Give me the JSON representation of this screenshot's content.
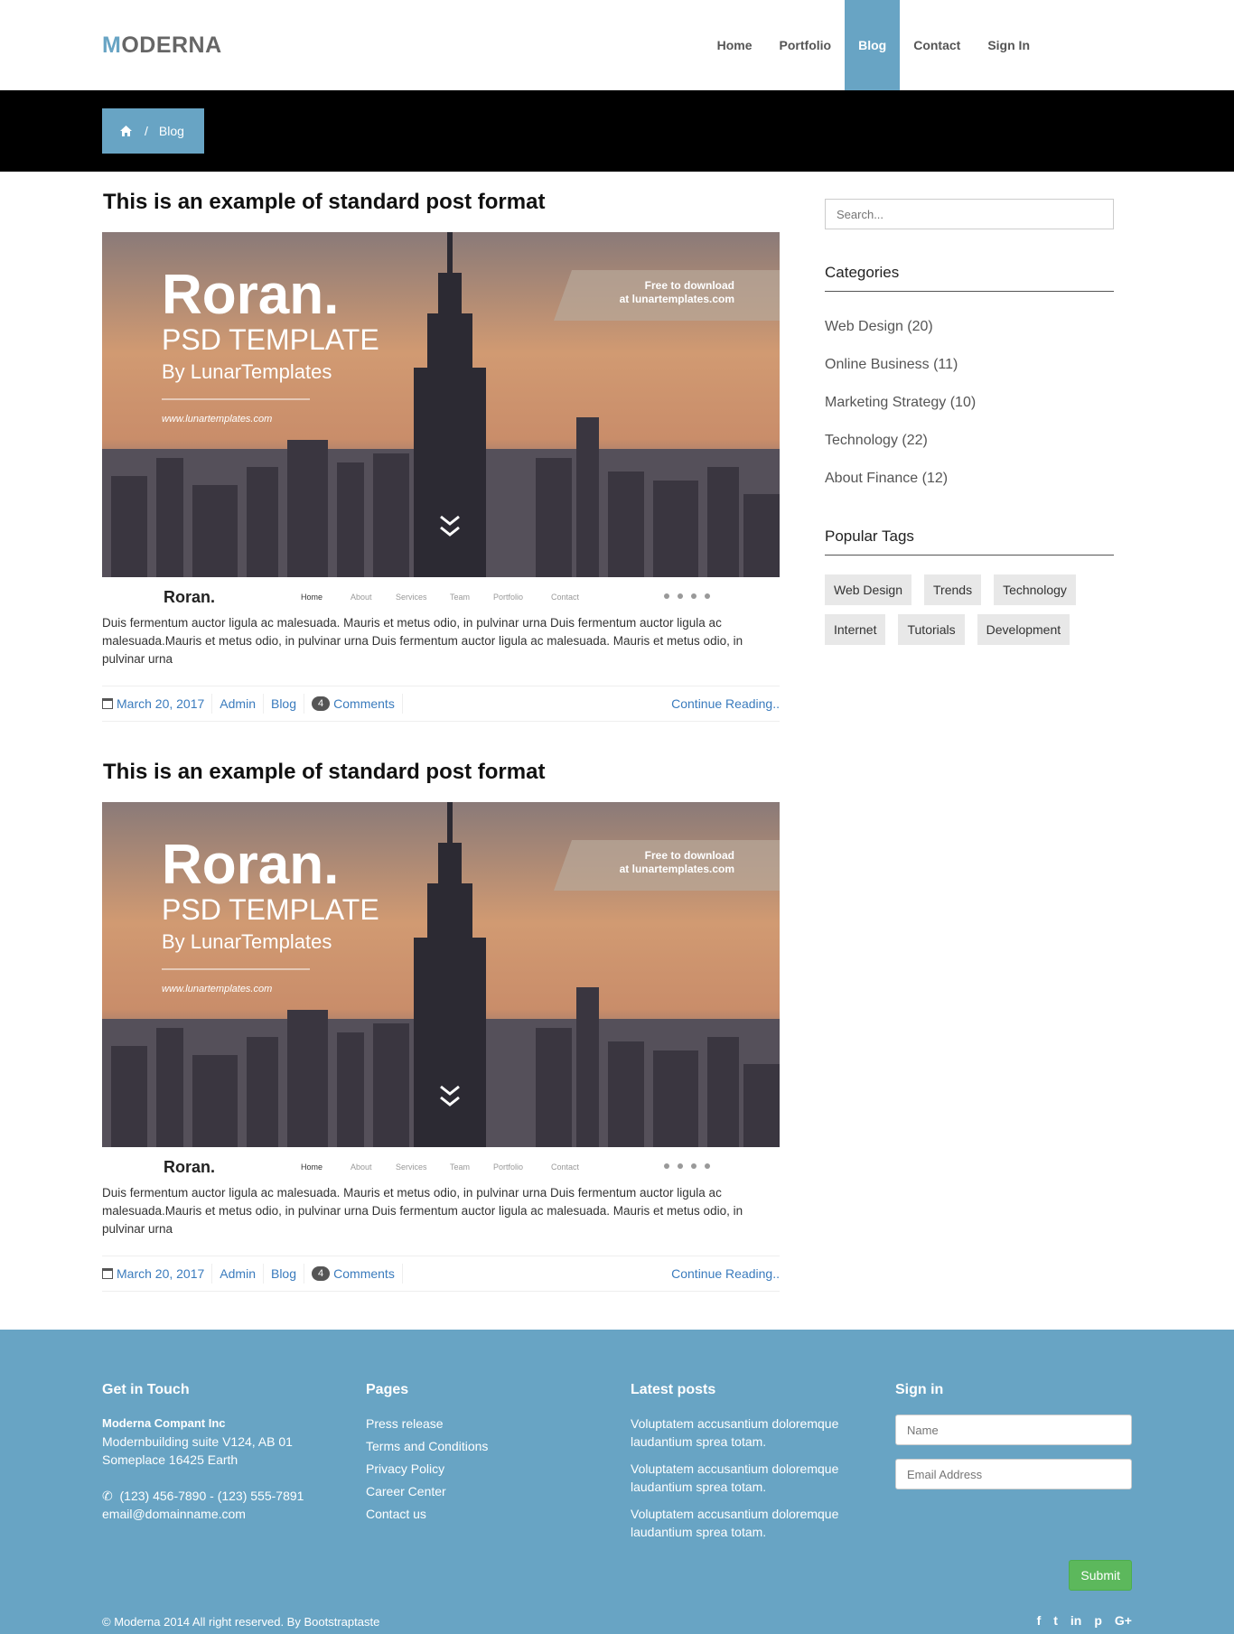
{
  "brand": {
    "first_letter": "M",
    "rest": "ODERNA"
  },
  "nav": {
    "home": "Home",
    "portfolio": "Portfolio",
    "blog": "Blog",
    "contact": "Contact",
    "signin": "Sign In"
  },
  "breadcrumb": {
    "separator": "/",
    "current": "Blog"
  },
  "posts": [
    {
      "title": "This is an example of standard post format",
      "image": {
        "headline": "Roran.",
        "subhead": "PSD TEMPLATE",
        "byline": "By LunarTemplates",
        "url": "www.lunartemplates.com",
        "ribbon1": "Free to download",
        "ribbon2": "at lunartemplates.com",
        "nav_brand": "Roran.",
        "nav_items": [
          "Home",
          "About",
          "Services",
          "Team",
          "Portfolio",
          "Contact"
        ]
      },
      "excerpt": "Duis fermentum auctor ligula ac malesuada. Mauris et metus odio, in pulvinar urna Duis fermentum auctor ligula ac malesuada.Mauris et metus odio, in pulvinar urna Duis fermentum auctor ligula ac malesuada. Mauris et metus odio, in pulvinar urna",
      "date": "March 20, 2017",
      "author": "Admin",
      "category": "Blog",
      "comment_count": "4",
      "comments_label": "Comments",
      "continue": "Continue Reading.."
    },
    {
      "title": "This is an example of standard post format",
      "image": {
        "headline": "Roran.",
        "subhead": "PSD TEMPLATE",
        "byline": "By LunarTemplates",
        "url": "www.lunartemplates.com",
        "ribbon1": "Free to download",
        "ribbon2": "at lunartemplates.com",
        "nav_brand": "Roran.",
        "nav_items": [
          "Home",
          "About",
          "Services",
          "Team",
          "Portfolio",
          "Contact"
        ]
      },
      "excerpt": "Duis fermentum auctor ligula ac malesuada. Mauris et metus odio, in pulvinar urna Duis fermentum auctor ligula ac malesuada.Mauris et metus odio, in pulvinar urna Duis fermentum auctor ligula ac malesuada. Mauris et metus odio, in pulvinar urna",
      "date": "March 20, 2017",
      "author": "Admin",
      "category": "Blog",
      "comment_count": "4",
      "comments_label": "Comments",
      "continue": "Continue Reading.."
    }
  ],
  "sidebar": {
    "search_placeholder": "Search...",
    "categories_title": "Categories",
    "categories": [
      "Web Design (20)",
      "Online Business (11)",
      "Marketing Strategy (10)",
      "Technology (22)",
      "About Finance (12)"
    ],
    "tags_title": "Popular Tags",
    "tags": [
      "Web Design",
      "Trends",
      "Technology",
      "Internet",
      "Tutorials",
      "Development"
    ]
  },
  "footer": {
    "touch_title": "Get in Touch",
    "company": "Moderna Compant Inc",
    "address1": "Modernbuilding suite V124, AB 01",
    "address2": "Someplace 16425 Earth",
    "phone": "(123) 456-7890 - (123) 555-7891",
    "email": "email@domainname.com",
    "pages_title": "Pages",
    "pages": [
      "Press release",
      "Terms and Conditions",
      "Privacy Policy",
      "Career Center",
      "Contact us"
    ],
    "latest_title": "Latest posts",
    "latest": [
      "Voluptatem accusantium doloremque laudantium sprea totam.",
      "Voluptatem accusantium doloremque laudantium sprea totam.",
      "Voluptatem accusantium doloremque laudantium sprea totam."
    ],
    "signin_title": "Sign in",
    "name_placeholder": "Name",
    "email_placeholder": "Email Address",
    "submit": "Submit",
    "copyright": "© Moderna 2014 All right reserved. By Bootstraptaste",
    "social": [
      "f",
      "t",
      "in",
      "p",
      "G+"
    ]
  },
  "colors": {
    "accent": "#68a4c4",
    "link": "#3a7bbd",
    "submit": "#5cb85c"
  }
}
